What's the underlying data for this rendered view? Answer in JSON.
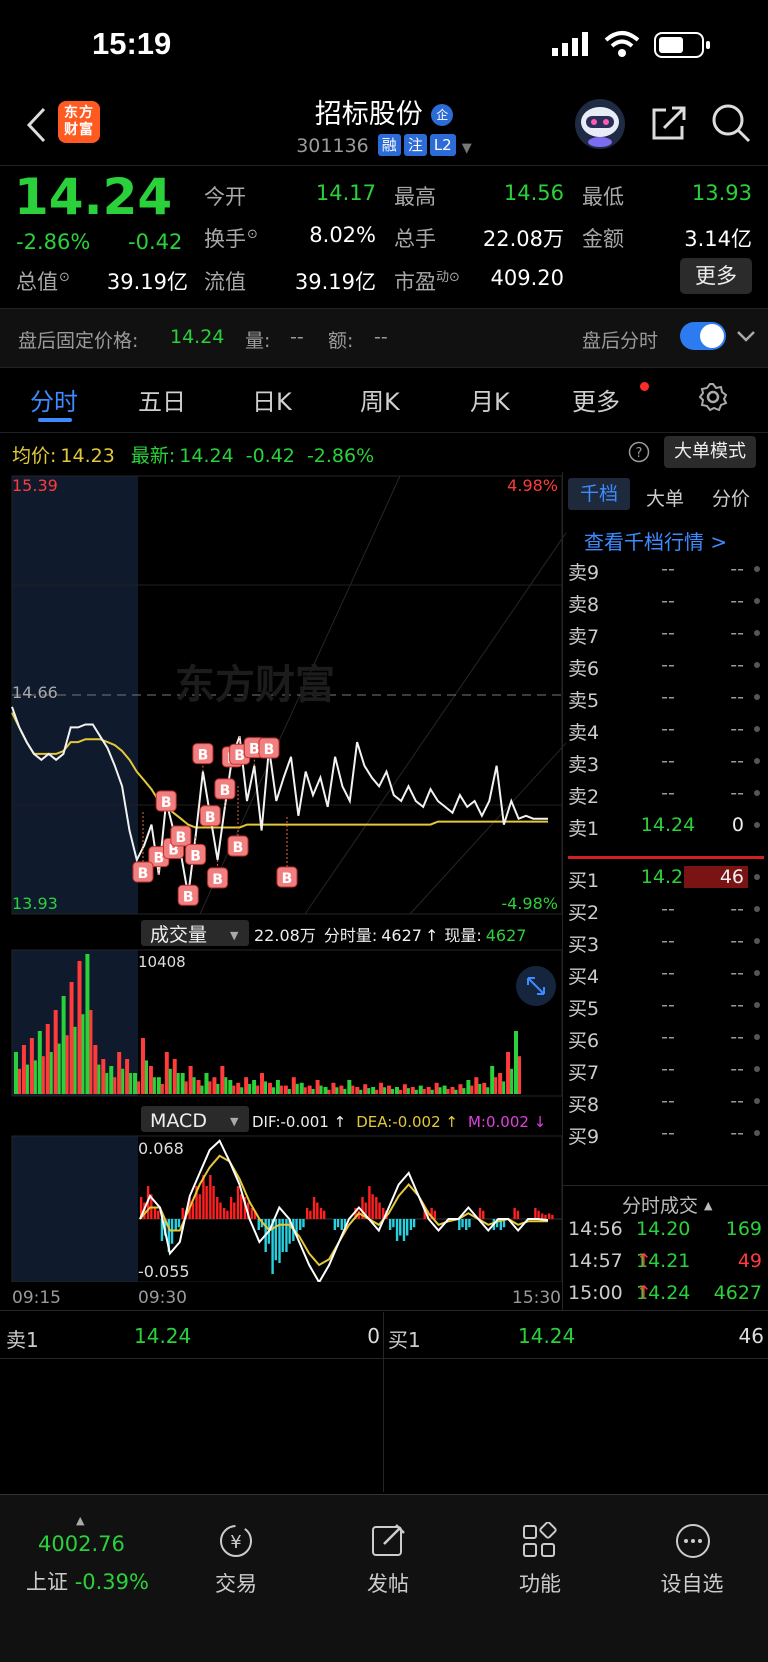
{
  "status": {
    "time": "15:19"
  },
  "header": {
    "logo_text": "东方财富",
    "stock_name": "招标股份",
    "name_badge": "企",
    "code": "301136",
    "tags": [
      "融",
      "注",
      "L2"
    ]
  },
  "quote": {
    "price": "14.24",
    "change_pct": "-2.86%",
    "change": "-0.42",
    "open_label": "今开",
    "open": "14.17",
    "high_label": "最高",
    "high": "14.56",
    "low_label": "最低",
    "low": "13.93",
    "turnover_label": "换手",
    "turnover": "8.02%",
    "volume_label": "总手",
    "volume": "22.08万",
    "amount_label": "金额",
    "amount": "3.14亿",
    "mktcap_label": "总值",
    "mktcap": "39.19亿",
    "float_label": "流值",
    "float": "39.19亿",
    "pe_label": "市盈",
    "pe_sup": "动",
    "pe": "409.20",
    "more_button": "更多"
  },
  "after_hours": {
    "fixed_price_label": "盘后固定价格:",
    "fixed_price": "14.24",
    "vol_label": "量:",
    "vol": "--",
    "amt_label": "额:",
    "amt": "--",
    "toggle_label": "盘后分时"
  },
  "tabs": [
    "分时",
    "五日",
    "日K",
    "周K",
    "月K",
    "更多"
  ],
  "info_bar": {
    "avg_label": "均价:",
    "avg": "14.23",
    "latest_label": "最新:",
    "latest": "14.24",
    "latest_chg": "-0.42",
    "latest_pct": "-2.86%",
    "mode_button": "大单模式"
  },
  "chart_data": {
    "type": "line",
    "price_axis": {
      "top": "15.39",
      "mid": "14.66",
      "bottom": "13.93",
      "top_pct": "4.98%",
      "bottom_pct": "-4.98%"
    },
    "time_labels": [
      "09:15",
      "09:30",
      "15:30"
    ],
    "prev_close": 14.66,
    "ylim": [
      13.93,
      15.39
    ],
    "series": [
      {
        "values": [
          14.62,
          14.55,
          14.5,
          14.46,
          14.44,
          14.46,
          14.44,
          14.46,
          14.55,
          14.55,
          14.56,
          14.56,
          14.52,
          14.48,
          14.42,
          14.35,
          14.2,
          14.1,
          14.15,
          14.22,
          14.05,
          14.3,
          14.2,
          14.12,
          13.98,
          14.18,
          14.4,
          14.25,
          14.1,
          14.28,
          14.45,
          14.52,
          14.3,
          14.42,
          14.2,
          14.48,
          14.3,
          14.38,
          14.45,
          14.25,
          14.4,
          14.32,
          14.38,
          14.28,
          14.45,
          14.35,
          14.3,
          14.5,
          14.42,
          14.38,
          14.35,
          14.4,
          14.32,
          14.3,
          14.35,
          14.3,
          14.28,
          14.34,
          14.3,
          14.28,
          14.26,
          14.32,
          14.28,
          14.3,
          14.25,
          14.3,
          14.42,
          14.22,
          14.3,
          14.24,
          14.25,
          14.24,
          14.24,
          14.24
        ]
      },
      {
        "values": [
          14.6,
          14.55,
          14.5,
          14.46,
          14.46,
          14.46,
          14.46,
          14.47,
          14.5,
          14.5,
          14.51,
          14.51,
          14.51,
          14.5,
          14.49,
          14.47,
          14.44,
          14.4,
          14.37,
          14.34,
          14.3,
          14.28,
          14.26,
          14.24,
          14.22,
          14.21,
          14.21,
          14.21,
          14.21,
          14.21,
          14.21,
          14.21,
          14.22,
          14.22,
          14.22,
          14.22,
          14.22,
          14.22,
          14.22,
          14.22,
          14.22,
          14.22,
          14.22,
          14.22,
          14.22,
          14.22,
          14.22,
          14.22,
          14.22,
          14.22,
          14.22,
          14.22,
          14.22,
          14.22,
          14.22,
          14.22,
          14.22,
          14.22,
          14.23,
          14.23,
          14.23,
          14.23,
          14.23,
          14.23,
          14.23,
          14.23,
          14.23,
          14.23,
          14.23,
          14.23,
          14.23,
          14.23,
          14.23,
          14.23
        ]
      }
    ],
    "big_order_marker": "B",
    "volume": {
      "label": "成交量",
      "total": "22.08万",
      "minute_label": "分时量:",
      "minute": "4627",
      "now_label": "现量:",
      "now": "4627",
      "max_label": "10408",
      "values": [
        0.3,
        0.35,
        0.4,
        0.45,
        0.5,
        0.6,
        0.7,
        0.8,
        0.95,
        1,
        0.35,
        0.25,
        0.2,
        0.3,
        0.25,
        0.15,
        0.4,
        0.2,
        0.12,
        0.3,
        0.25,
        0.15,
        0.2,
        0.1,
        0.15,
        0.12,
        0.2,
        0.1,
        0.08,
        0.12,
        0.1,
        0.15,
        0.08,
        0.1,
        0.06,
        0.12,
        0.08,
        0.06,
        0.1,
        0.05,
        0.08,
        0.06,
        0.1,
        0.05,
        0.07,
        0.05,
        0.08,
        0.06,
        0.05,
        0.07,
        0.05,
        0.06,
        0.05,
        0.08,
        0.06,
        0.05,
        0.07,
        0.1,
        0.12,
        0.08,
        0.2,
        0.15,
        0.3,
        0.45
      ]
    },
    "macd": {
      "label": "MACD",
      "dif": "DIF:-0.001",
      "dea": "DEA:-0.002",
      "m": "M:0.002",
      "max": "0.068",
      "min": "-0.055",
      "hist": [
        0.02,
        0.03,
        0.01,
        -0.02,
        -0.03,
        -0.01,
        0.01,
        0.02,
        0.03,
        0.04,
        0.04,
        0.02,
        0.01,
        0.02,
        0.03,
        0.02,
        0.01,
        -0.01,
        -0.03,
        -0.05,
        -0.04,
        -0.03,
        -0.02,
        -0.01,
        0.01,
        0.02,
        0.01,
        0.0,
        -0.01,
        -0.01,
        0.0,
        0.01,
        0.02,
        0.03,
        0.02,
        0.01,
        -0.01,
        -0.02,
        -0.02,
        -0.01,
        0.0,
        0.01,
        0.01,
        0.0,
        0.0,
        0.0,
        -0.01,
        -0.01,
        0.0,
        0.01,
        0.0,
        -0.01,
        -0.01,
        0.0,
        0.01,
        0.0,
        0.0,
        0.01,
        0.005,
        0.005
      ],
      "dif_line": [
        0.0,
        0.02,
        0.01,
        -0.03,
        -0.02,
        0.02,
        0.04,
        0.06,
        0.068,
        0.05,
        0.03,
        0.0,
        -0.02,
        -0.01,
        0.01,
        0.0,
        -0.02,
        -0.04,
        -0.055,
        -0.04,
        -0.02,
        0.0,
        0.01,
        0.0,
        -0.01,
        0.01,
        0.03,
        0.04,
        0.02,
        0.0,
        -0.01,
        0.0,
        0.0,
        0.01,
        0.0,
        -0.01,
        0.0,
        0.0,
        -0.01,
        0.0,
        0.0,
        -0.001
      ],
      "dea_line": [
        0.0,
        0.01,
        0.01,
        -0.01,
        -0.01,
        0.01,
        0.03,
        0.045,
        0.055,
        0.05,
        0.035,
        0.015,
        0.0,
        -0.01,
        -0.005,
        -0.005,
        -0.015,
        -0.03,
        -0.04,
        -0.035,
        -0.02,
        -0.005,
        0.005,
        0.0,
        -0.005,
        0.005,
        0.02,
        0.03,
        0.02,
        0.005,
        -0.005,
        -0.002,
        0.0,
        0.005,
        0.0,
        -0.005,
        -0.002,
        0.0,
        -0.005,
        -0.002,
        -0.002,
        -0.002
      ]
    }
  },
  "orderbook": {
    "tabs": [
      "千档",
      "大单",
      "分价"
    ],
    "link": "查看千档行情 >",
    "asks": [
      {
        "label": "卖9",
        "price": "--",
        "vol": "--"
      },
      {
        "label": "卖8",
        "price": "--",
        "vol": "--"
      },
      {
        "label": "卖7",
        "price": "--",
        "vol": "--"
      },
      {
        "label": "卖6",
        "price": "--",
        "vol": "--"
      },
      {
        "label": "卖5",
        "price": "--",
        "vol": "--"
      },
      {
        "label": "卖4",
        "price": "--",
        "vol": "--"
      },
      {
        "label": "卖3",
        "price": "--",
        "vol": "--"
      },
      {
        "label": "卖2",
        "price": "--",
        "vol": "--"
      },
      {
        "label": "卖1",
        "price": "14.24",
        "vol": "0"
      }
    ],
    "bids": [
      {
        "label": "买1",
        "price": "14.24",
        "vol": "46"
      },
      {
        "label": "买2",
        "price": "--",
        "vol": "--"
      },
      {
        "label": "买3",
        "price": "--",
        "vol": "--"
      },
      {
        "label": "买4",
        "price": "--",
        "vol": "--"
      },
      {
        "label": "买5",
        "price": "--",
        "vol": "--"
      },
      {
        "label": "买6",
        "price": "--",
        "vol": "--"
      },
      {
        "label": "买7",
        "price": "--",
        "vol": "--"
      },
      {
        "label": "买8",
        "price": "--",
        "vol": "--"
      },
      {
        "label": "买9",
        "price": "--",
        "vol": "--"
      }
    ],
    "trades_title": "分时成交",
    "trades": [
      {
        "time": "14:56",
        "price": "14.20",
        "vol": "169",
        "arrow": ""
      },
      {
        "time": "14:57",
        "price": "14.21",
        "vol": "49",
        "arrow": "↑"
      },
      {
        "time": "15:00",
        "price": "14.24",
        "vol": "4627",
        "arrow": "↑"
      }
    ]
  },
  "bottom_quote": {
    "ask_label": "卖1",
    "ask_price": "14.24",
    "ask_vol": "0",
    "bid_label": "买1",
    "bid_price": "14.24",
    "bid_vol": "46"
  },
  "nav": {
    "index_value": "4002.76",
    "index_name": "上证",
    "index_pct": "-0.39%",
    "items": [
      "交易",
      "发帖",
      "功能",
      "设自选"
    ]
  },
  "colors": {
    "up": "#ff3b3b",
    "down": "#2bd13b",
    "accent": "#2d6bd6",
    "avg": "#e3c93a"
  }
}
